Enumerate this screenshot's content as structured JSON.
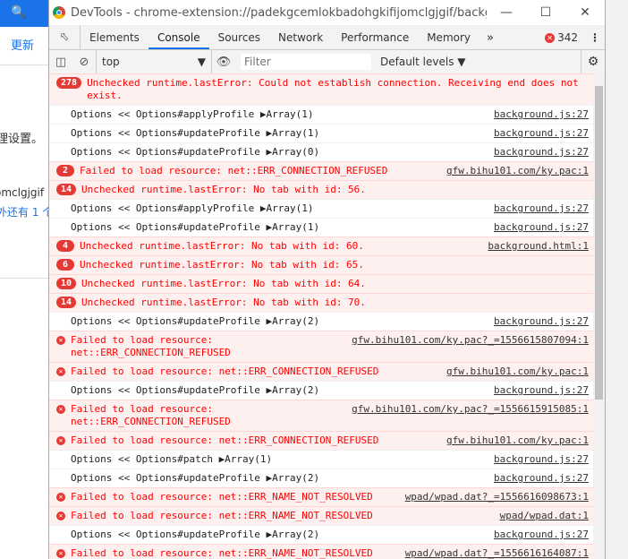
{
  "background": {
    "link": "更新",
    "text1": "理设置。",
    "text2": "omclgjgif",
    "text3": "外还有 1 个"
  },
  "window": {
    "title": "DevTools - chrome-extension://padekgcemlokbadohgkifijomclgjgif/backgrou...",
    "minimize": "—",
    "maximize": "☐",
    "close": "✕"
  },
  "tabs": [
    "Elements",
    "Console",
    "Sources",
    "Network",
    "Performance",
    "Memory"
  ],
  "tab_more": "»",
  "error_count": "342",
  "toolbar": {
    "context": "top",
    "filter_placeholder": "Filter",
    "levels": "Default levels ▼"
  },
  "colors": {
    "error": "#f00",
    "error_bg": "#fff0f0",
    "accent": "#1a73e8"
  },
  "messages": [
    {
      "type": "err",
      "count": "278",
      "text": "Unchecked runtime.lastError: Could not establish connection. Receiving end does not exist.",
      "source": ""
    },
    {
      "type": "log",
      "text": "Options << Options#applyProfile ▶Array(1)",
      "source": "background.js:27"
    },
    {
      "type": "log",
      "text": "Options << Options#updateProfile ▶Array(1)",
      "source": "background.js:27"
    },
    {
      "type": "log",
      "text": "Options << Options#updateProfile ▶Array(0)",
      "source": "background.js:27"
    },
    {
      "type": "err",
      "count": "2",
      "text": "Failed to load resource: net::ERR_CONNECTION_REFUSED",
      "source": "gfw.bihu101.com/ky.pac:1"
    },
    {
      "type": "err",
      "count": "14",
      "text": "Unchecked runtime.lastError: No tab with id: 56.",
      "source": ""
    },
    {
      "type": "log",
      "text": "Options << Options#applyProfile ▶Array(1)",
      "source": "background.js:27"
    },
    {
      "type": "log",
      "text": "Options << Options#updateProfile ▶Array(1)",
      "source": "background.js:27"
    },
    {
      "type": "err",
      "count": "4",
      "text": "Unchecked runtime.lastError: No tab with id: 60.",
      "source": "background.html:1"
    },
    {
      "type": "err",
      "count": "6",
      "text": "Unchecked runtime.lastError: No tab with id: 65.",
      "source": ""
    },
    {
      "type": "err",
      "count": "10",
      "text": "Unchecked runtime.lastError: No tab with id: 64.",
      "source": ""
    },
    {
      "type": "err",
      "count": "14",
      "text": "Unchecked runtime.lastError: No tab with id: 70.",
      "source": ""
    },
    {
      "type": "log",
      "text": "Options << Options#updateProfile ▶Array(2)",
      "source": "background.js:27"
    },
    {
      "type": "err",
      "count": "",
      "text": "Failed to load resource: net::ERR_CONNECTION_REFUSED",
      "source": "gfw.bihu101.com/ky.pac?_=1556615807094:1"
    },
    {
      "type": "err",
      "count": "",
      "text": "Failed to load resource: net::ERR_CONNECTION_REFUSED",
      "source": "gfw.bihu101.com/ky.pac:1"
    },
    {
      "type": "log",
      "text": "Options << Options#updateProfile ▶Array(2)",
      "source": "background.js:27"
    },
    {
      "type": "err",
      "count": "",
      "text": "Failed to load resource: net::ERR_CONNECTION_REFUSED",
      "source": "gfw.bihu101.com/ky.pac?_=1556615915085:1"
    },
    {
      "type": "err",
      "count": "",
      "text": "Failed to load resource: net::ERR_CONNECTION_REFUSED",
      "source": "gfw.bihu101.com/ky.pac:1"
    },
    {
      "type": "log",
      "text": "Options << Options#patch ▶Array(1)",
      "source": "background.js:27"
    },
    {
      "type": "log",
      "text": "Options << Options#updateProfile ▶Array(2)",
      "source": "background.js:27"
    },
    {
      "type": "err",
      "count": "",
      "text": "Failed to load resource: net::ERR_NAME_NOT_RESOLVED",
      "source": "wpad/wpad.dat?_=1556616098673:1"
    },
    {
      "type": "err",
      "count": "",
      "text": "Failed to load resource: net::ERR_NAME_NOT_RESOLVED",
      "source": "wpad/wpad.dat:1"
    },
    {
      "type": "log",
      "text": "Options << Options#updateProfile ▶Array(2)",
      "source": "background.js:27"
    },
    {
      "type": "err",
      "count": "",
      "text": "Failed to load resource: net::ERR_NAME_NOT_RESOLVED",
      "source": "wpad/wpad.dat?_=1556616164087:1"
    }
  ]
}
